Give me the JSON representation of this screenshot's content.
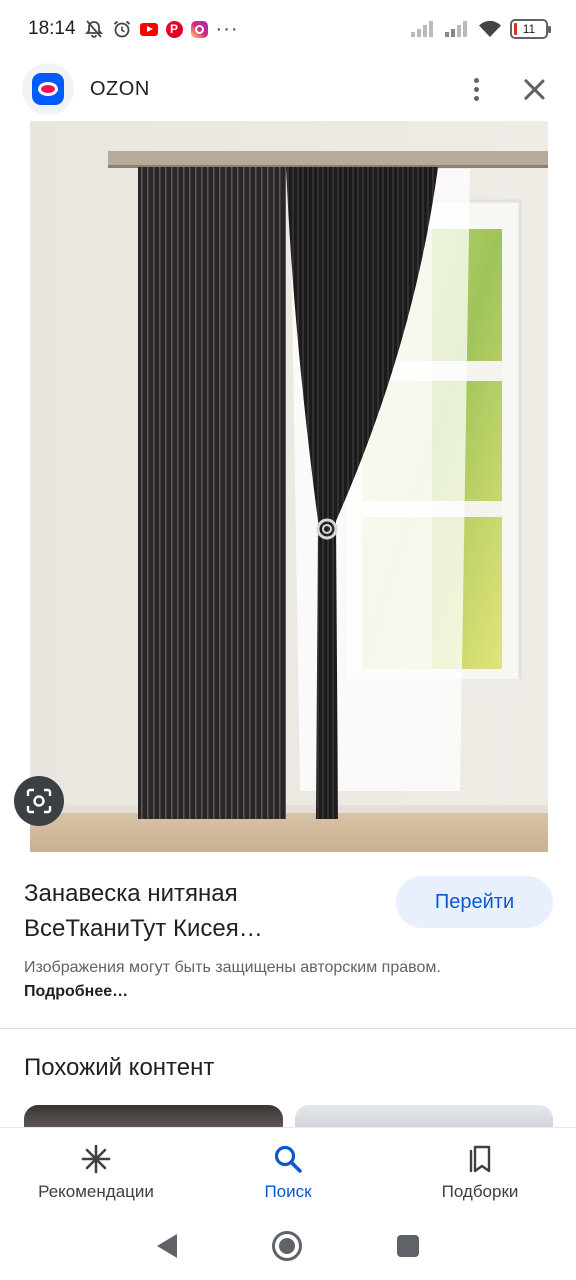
{
  "status_bar": {
    "time": "18:14",
    "battery_level": "11",
    "battery_fraction": 0.11,
    "more_indicator": "···"
  },
  "header": {
    "app_title": "OZON"
  },
  "product": {
    "title": "Занавеска нитяная ВсеТканиТут Кисея…",
    "go_button_label": "Перейти",
    "copyright_text": "Изображения могут быть защищены авторским правом.",
    "copyright_link": "Подробнее…"
  },
  "related": {
    "title": "Похожий контент"
  },
  "bottom_nav": {
    "items": [
      {
        "label": "Рекомендации",
        "icon": "asterisk-icon",
        "active": false
      },
      {
        "label": "Поиск",
        "icon": "search-icon",
        "active": true
      },
      {
        "label": "Подборки",
        "icon": "collections-icon",
        "active": false
      }
    ]
  },
  "colors": {
    "accent": "#0b57d0",
    "button_bg": "#e8f0fe",
    "ozon_blue": "#005bff",
    "ozon_pink": "#f91155"
  }
}
